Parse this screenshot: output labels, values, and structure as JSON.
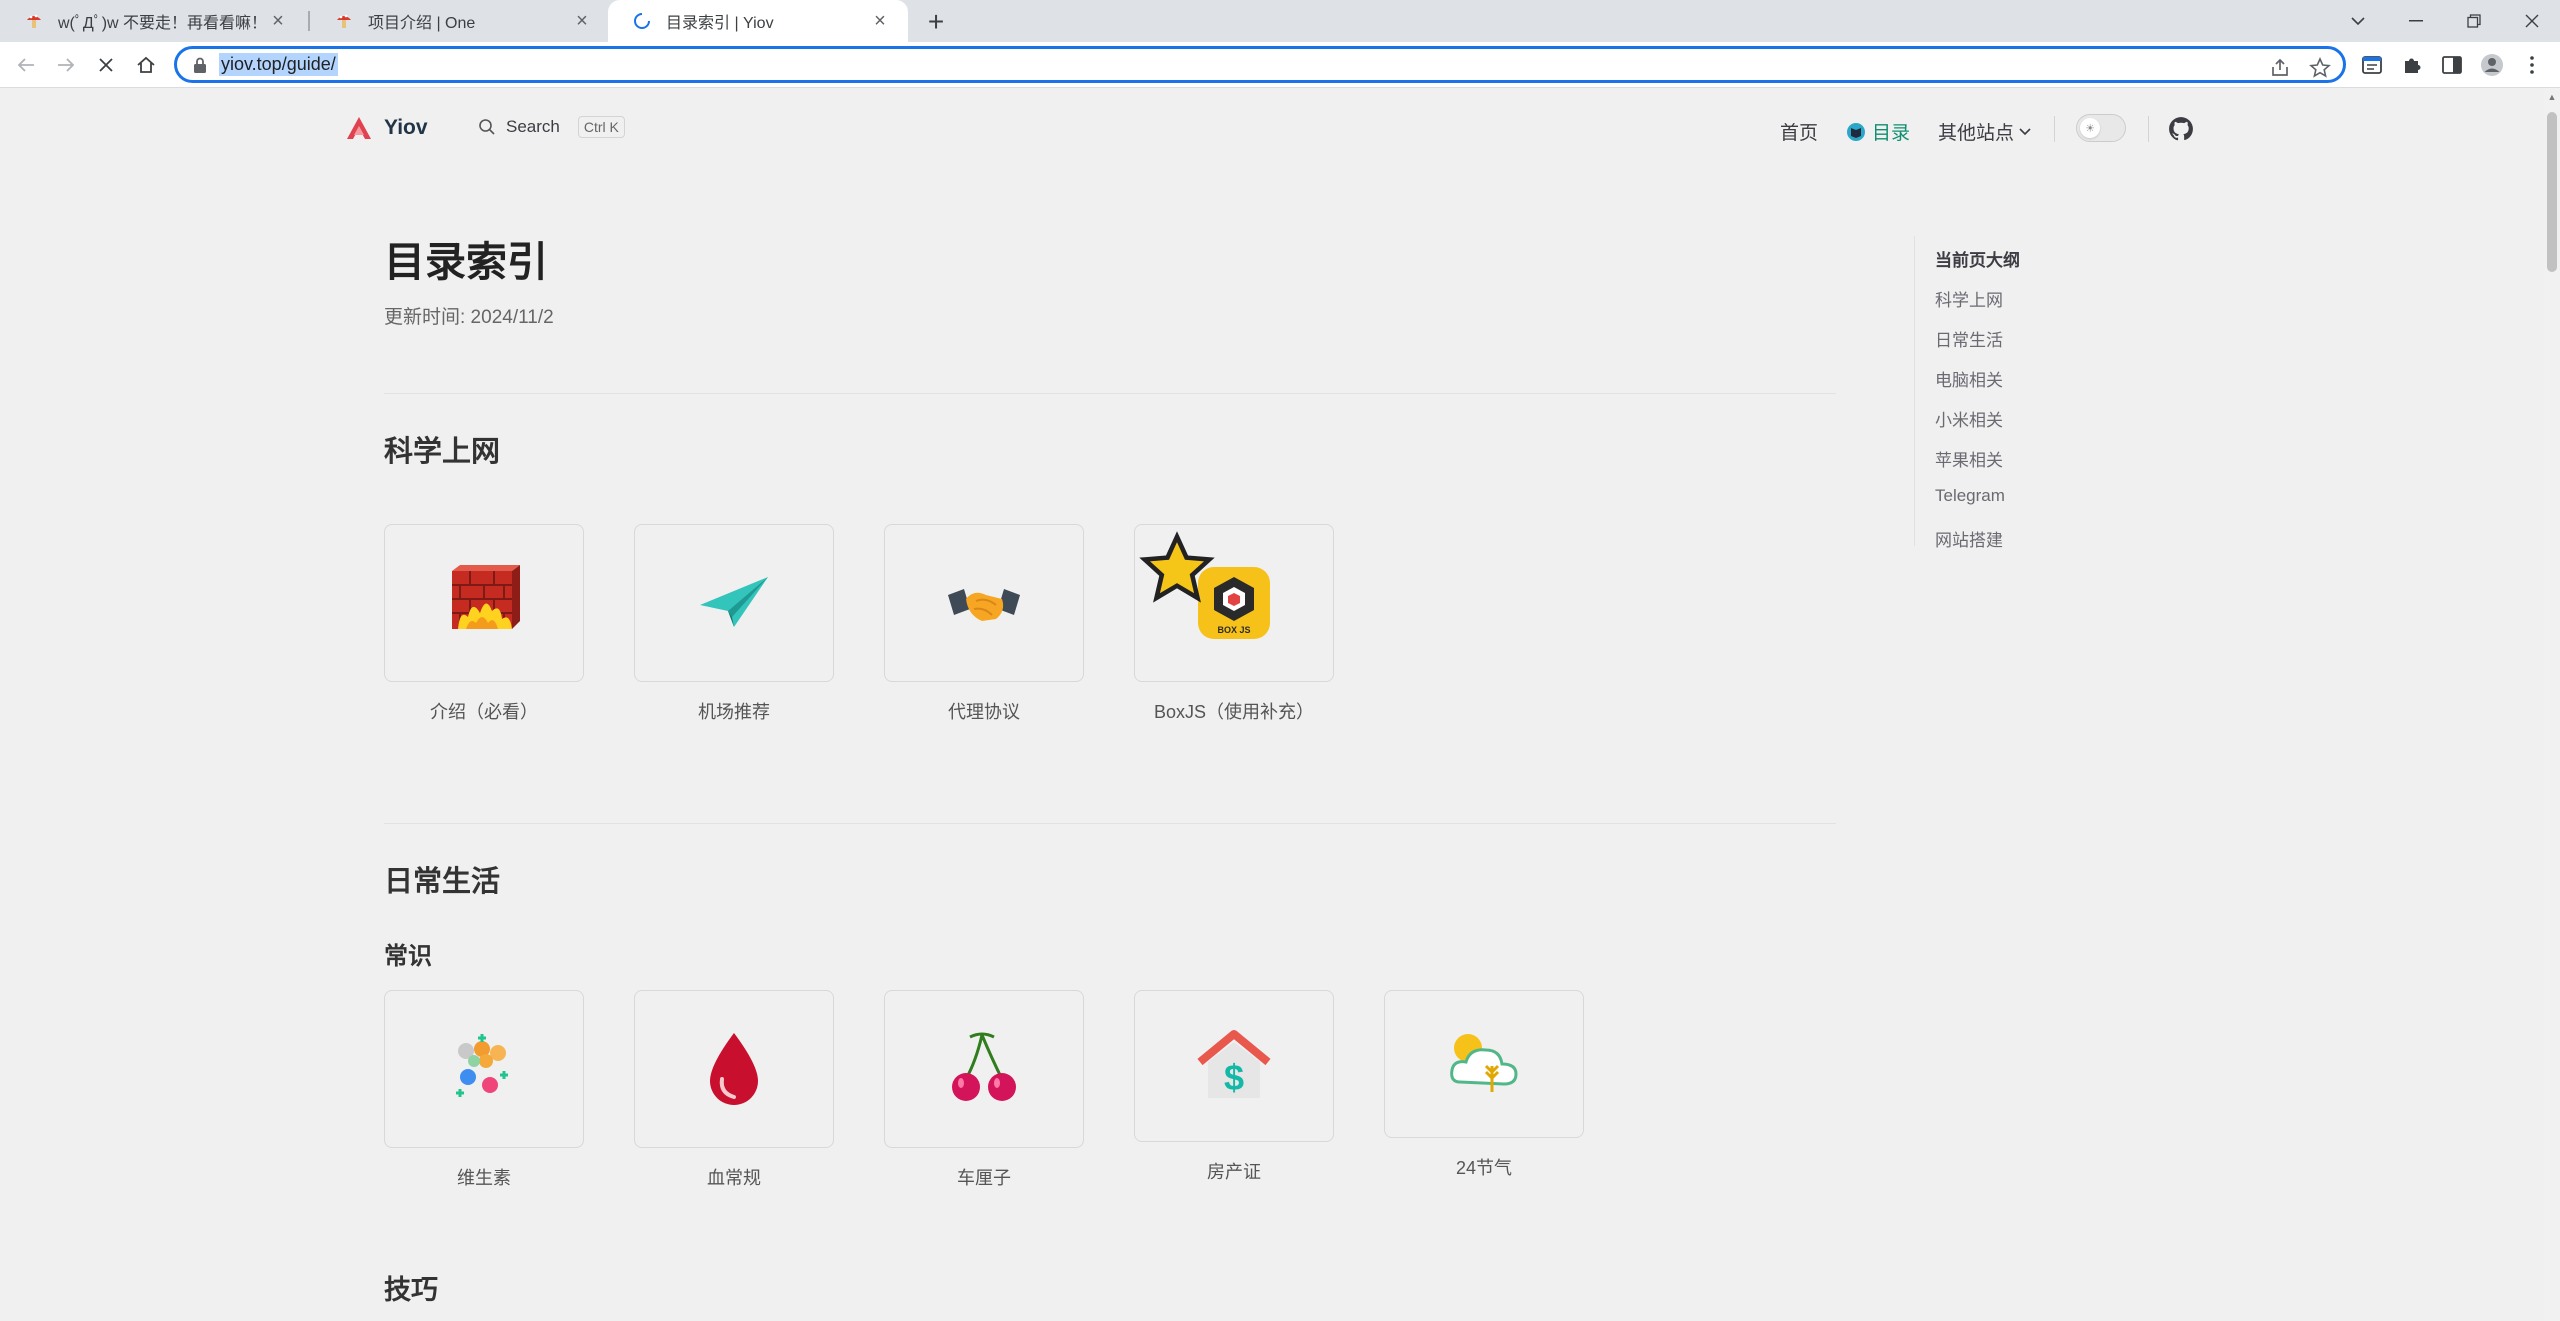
{
  "browser": {
    "tabs": [
      {
        "title": "w(ﾟДﾟ)w 不要走！再看看嘛！",
        "active": false
      },
      {
        "title": "项目介绍 | One",
        "active": false
      },
      {
        "title": "目录索引 | Yiov",
        "active": true
      }
    ],
    "url": "yiov.top/guide/"
  },
  "site": {
    "name": "Yiov",
    "search_label": "Search",
    "search_shortcut": "Ctrl K",
    "nav": {
      "home": "首页",
      "catalog": "目录",
      "other": "其他站点"
    }
  },
  "page": {
    "title": "目录索引",
    "updated": "更新时间: 2024/11/2",
    "sections": {
      "science": {
        "title": "科学上网",
        "cards": [
          "介绍（必看）",
          "机场推荐",
          "代理协议",
          "BoxJS（使用补充）"
        ]
      },
      "daily": {
        "title": "日常生活",
        "subtitle": "常识",
        "cards": [
          "维生素",
          "血常规",
          "车厘子",
          "房产证",
          "24节气"
        ]
      },
      "tips": {
        "title": "技巧"
      }
    }
  },
  "outline": {
    "title": "当前页大纲",
    "items": [
      "科学上网",
      "日常生活",
      "电脑相关",
      "小米相关",
      "苹果相关",
      "Telegram",
      "网站搭建"
    ]
  },
  "colors": {
    "brand_green": "#0f8f6f",
    "omnibox_blue": "#1a73e8"
  }
}
